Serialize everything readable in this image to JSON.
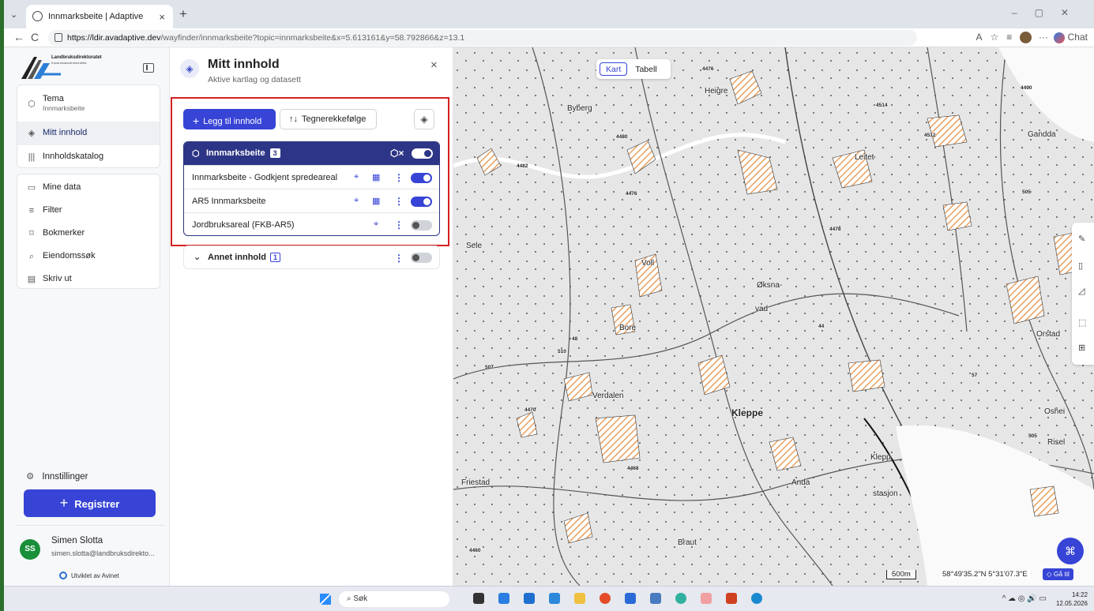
{
  "browser": {
    "tab_title": "Innmarksbeite | Adaptive",
    "url_host": "https://ldir.avadaptive.dev",
    "url_path": "/wayfinder/innmarksbeite?topic=innmarksbeite&x=5.613161&y=58.792866&z=13.1",
    "chat_label": "Chat"
  },
  "sidebar": {
    "logo_title": "Landbruksdirektoratet",
    "logo_subtitle": "Eanandoallodirektoráhtta",
    "items_top": [
      {
        "label": "Tema",
        "sub": "Innmarksbeite"
      },
      {
        "label": "Mitt innhold"
      },
      {
        "label": "Innholdskatalog"
      }
    ],
    "items_bottom": [
      {
        "label": "Mine data"
      },
      {
        "label": "Filter"
      },
      {
        "label": "Bokmerker"
      },
      {
        "label": "Eiendomssøk"
      },
      {
        "label": "Skriv ut"
      }
    ],
    "settings": "Innstillinger",
    "register": "Registrer",
    "user_initials": "SS",
    "user_name": "Simen Slotta",
    "user_email": "simen.slotta@landbruksdirekto...",
    "developed_by": "Utviklet av Avinet"
  },
  "panel": {
    "title": "Mitt innhold",
    "subtitle": "Aktive kartlag og datasett",
    "add_button": "Legg til innhold",
    "order_button": "Tegnerekkefølge",
    "group": {
      "name": "Innmarksbeite",
      "count": "3"
    },
    "layers": [
      {
        "name": "Innmarksbeite - Godkjent spredeareal",
        "enabled": true
      },
      {
        "name": "AR5 Innmarksbeite",
        "enabled": true
      },
      {
        "name": "Jordbruksareal (FKB-AR5)",
        "enabled": false
      }
    ],
    "other": {
      "name": "Annet innhold",
      "count": "1"
    }
  },
  "map": {
    "view_map": "Kart",
    "view_table": "Tabell",
    "labels": [
      "Byberg",
      "Heigre",
      "Leitet",
      "Gandda",
      "Sele",
      "Voll",
      "Øksna-",
      "vad",
      "Bore",
      "Orstad",
      "Verdalen",
      "Kleppe",
      "Oshei",
      "Risel",
      "Friestad",
      "Anda",
      "Klepp",
      "stasjon",
      "Braut"
    ],
    "road_numbers": [
      "4476",
      "4514",
      "4490",
      "4480",
      "4512",
      "4482",
      "4476",
      "505",
      "4478",
      "44",
      "48",
      "510",
      "507",
      "4470",
      "4468",
      "57",
      "505",
      "4460"
    ],
    "scale": "500m",
    "coords": "58°49'35.2\"N 5°31'07.3\"E",
    "goto": "Gå til"
  },
  "taskbar": {
    "search": "Søk",
    "time": "14:22",
    "date": "12.05.2026"
  },
  "colors": {
    "primary": "#3744d6",
    "group_header": "#2d3586",
    "highlight_box": "#d42020"
  }
}
